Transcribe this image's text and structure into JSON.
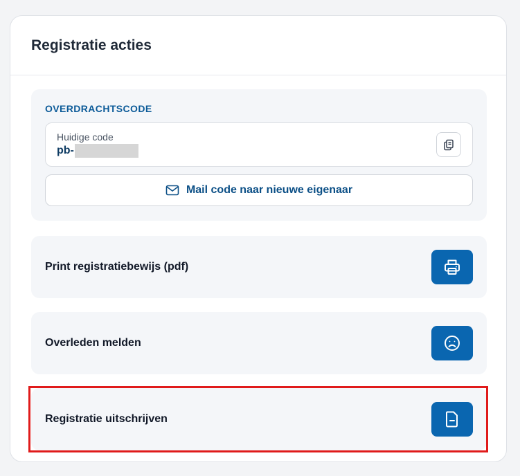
{
  "card": {
    "title": "Registratie acties"
  },
  "transfer": {
    "section_label": "OVERDRACHTSCODE",
    "current_code_label": "Huidige code",
    "code_prefix": "pb-",
    "mail_button_label": "Mail code naar nieuwe eigenaar"
  },
  "actions": [
    {
      "label": "Print registratiebewijs (pdf)",
      "icon": "printer-icon"
    },
    {
      "label": "Overleden melden",
      "icon": "sad-face-icon"
    },
    {
      "label": "Registratie uitschrijven",
      "icon": "document-minus-icon"
    }
  ],
  "colors": {
    "accent": "#0a66b0",
    "section_label": "#0b5a98",
    "highlight": "#e01b1b"
  }
}
